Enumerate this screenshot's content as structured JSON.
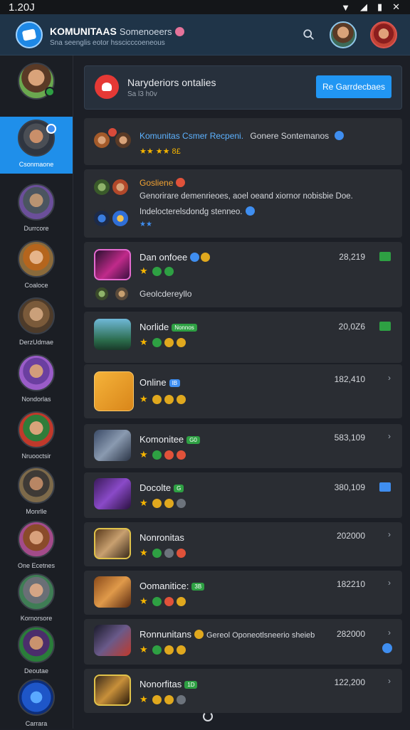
{
  "status": {
    "time": "1.20J",
    "icons": [
      "wifi-icon",
      "signal-icon",
      "battery-icon",
      "close-icon"
    ]
  },
  "app": {
    "title": "KOMUNITAAS",
    "title_suffix": "Somenoeers",
    "subtitle": "Sna seenglis eotor hsscicccoeneous"
  },
  "banner": {
    "title": "Naryderiors ontalies",
    "subtitle": "Sa l3 h0v",
    "button": "Re Garrdecbaes"
  },
  "sidebar": [
    {
      "label": ""
    },
    {
      "label": "Csonmaone"
    },
    {
      "label": "Durrcore"
    },
    {
      "label": "Coaloce"
    },
    {
      "label": "DerzUdmae"
    },
    {
      "label": "Nondorlas"
    },
    {
      "label": "Nruooctsir"
    },
    {
      "label": "Monrlle"
    },
    {
      "label": "One Ecetnes"
    },
    {
      "label": "Kornorsore"
    },
    {
      "label": "Deoutae"
    },
    {
      "label": "Carrara"
    }
  ],
  "feed": {
    "highlight": {
      "title": "Komunitas Csmer Recpeni.",
      "extra": "Gonere Sontemanos",
      "rating": "★★ ★★ 8£"
    },
    "group": {
      "title": "Gosliene",
      "line1": "Genorirare demenrieoes, aoel oeand xiornor nobisbie Doe.",
      "line2": "Indelocterelsdondg stenneo.",
      "stars": "★★"
    },
    "items": [
      {
        "title": "Dan onfoee",
        "tag": "",
        "count": "28,219",
        "sub": "Geolcdereyllo"
      },
      {
        "title": "Norlide",
        "tag": "Nonnos",
        "count": "20,0Z6"
      },
      {
        "title": "Online",
        "tag": "IB",
        "count": "182,410"
      },
      {
        "title": "Komonitee",
        "tag": "G0",
        "count": "583,109"
      },
      {
        "title": "Docolte",
        "tag": "G",
        "count": "380,109"
      },
      {
        "title": "Nonronitas",
        "tag": "",
        "count": "202000"
      },
      {
        "title": "Oomanitice:",
        "tag": "3B",
        "count": "182210"
      },
      {
        "title": "Ronnunitans",
        "tag": "Gereol Oponeotlsneerio sheieb",
        "count": "282000"
      },
      {
        "title": "Nonorfitas",
        "tag": "1D",
        "count": "122,200"
      }
    ]
  },
  "colors": {
    "accent": "#1f8fea",
    "card": "#2a2d33",
    "bg": "#1c1f26"
  }
}
